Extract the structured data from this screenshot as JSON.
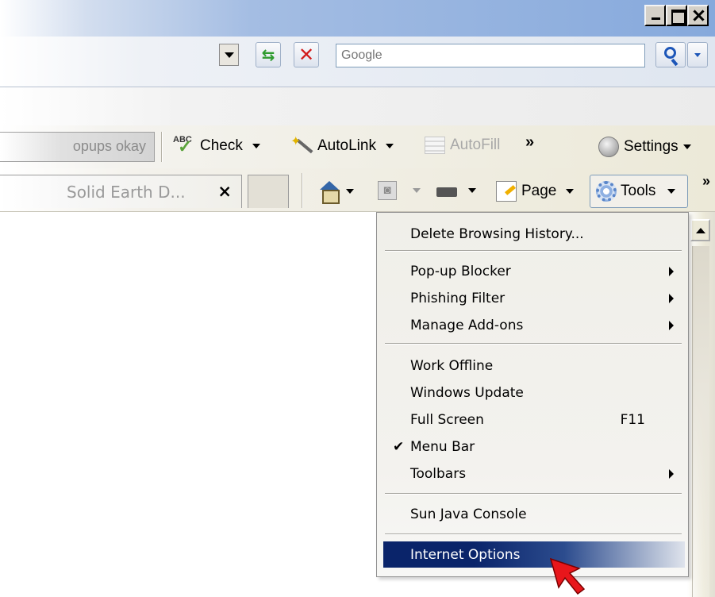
{
  "window": {
    "buttons": {
      "minimize": "minimize",
      "maximize": "maximize",
      "close": "close"
    }
  },
  "address": {
    "search_placeholder": "Google"
  },
  "google_toolbar": {
    "popups": "opups okay",
    "check": "Check",
    "autolink": "AutoLink",
    "autofill": "AutoFill",
    "more": "»",
    "settings": "Settings"
  },
  "tabs": {
    "active_title": "Solid Earth D...",
    "close": "×"
  },
  "command_bar": {
    "page": "Page",
    "tools": "Tools",
    "more": "»"
  },
  "tools_menu": {
    "items": [
      {
        "label": "Delete Browsing History..."
      },
      {
        "label": "Pop-up Blocker",
        "submenu": true
      },
      {
        "label": "Phishing Filter",
        "submenu": true
      },
      {
        "label": "Manage Add-ons",
        "submenu": true
      },
      {
        "label": "Work Offline"
      },
      {
        "label": "Windows Update"
      },
      {
        "label": "Full Screen",
        "shortcut": "F11"
      },
      {
        "label": "Menu Bar",
        "checked": true,
        "check_mark": "✔"
      },
      {
        "label": "Toolbars",
        "submenu": true
      },
      {
        "label": "Sun Java Console"
      },
      {
        "label": "Internet Options",
        "highlighted": true
      }
    ]
  },
  "colors": {
    "menu_highlight": "#0a246a",
    "cursor": "#e8161b"
  }
}
